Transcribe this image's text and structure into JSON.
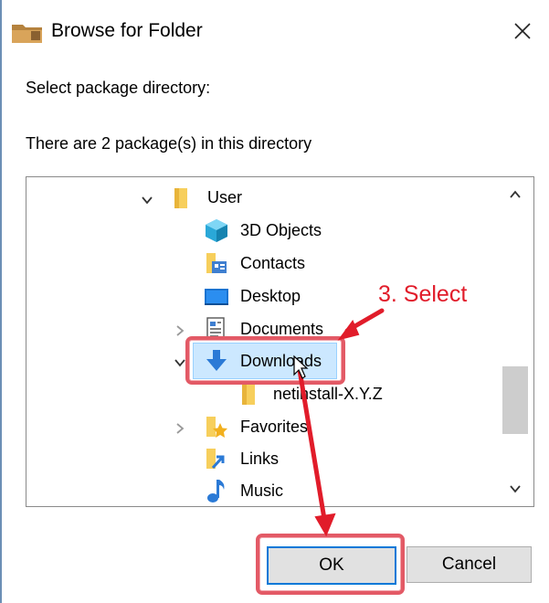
{
  "window": {
    "title": "Browse for Folder",
    "close_label": "✕"
  },
  "dialog": {
    "prompt": "Select package directory:",
    "status": "There are 2 package(s) in this directory"
  },
  "tree": {
    "items": [
      {
        "label": "User",
        "icon": "folder-icon",
        "expander": "expanded",
        "level": 0
      },
      {
        "label": "3D Objects",
        "icon": "3d-objects-icon",
        "expander": "none",
        "level": 1
      },
      {
        "label": "Contacts",
        "icon": "contacts-icon",
        "expander": "none",
        "level": 1
      },
      {
        "label": "Desktop",
        "icon": "desktop-icon",
        "expander": "none",
        "level": 1
      },
      {
        "label": "Documents",
        "icon": "documents-icon",
        "expander": "collapsed",
        "level": 1
      },
      {
        "label": "Downloads",
        "icon": "downloads-icon",
        "expander": "expanded",
        "level": 1,
        "selected": true
      },
      {
        "label": "netinstall-X.Y.Z",
        "icon": "folder-icon",
        "expander": "none",
        "level": 2
      },
      {
        "label": "Favorites",
        "icon": "favorites-icon",
        "expander": "collapsed",
        "level": 1
      },
      {
        "label": "Links",
        "icon": "links-icon",
        "expander": "none",
        "level": 1
      },
      {
        "label": "Music",
        "icon": "music-icon",
        "expander": "none",
        "level": 1
      }
    ]
  },
  "buttons": {
    "ok": "OK",
    "cancel": "Cancel"
  },
  "annotation": {
    "text": "3. Select",
    "color": "#e11c2a",
    "highlight_color": "#e35a66"
  },
  "colors": {
    "selection": "#cce8ff",
    "default_button_border": "#0078d7"
  }
}
